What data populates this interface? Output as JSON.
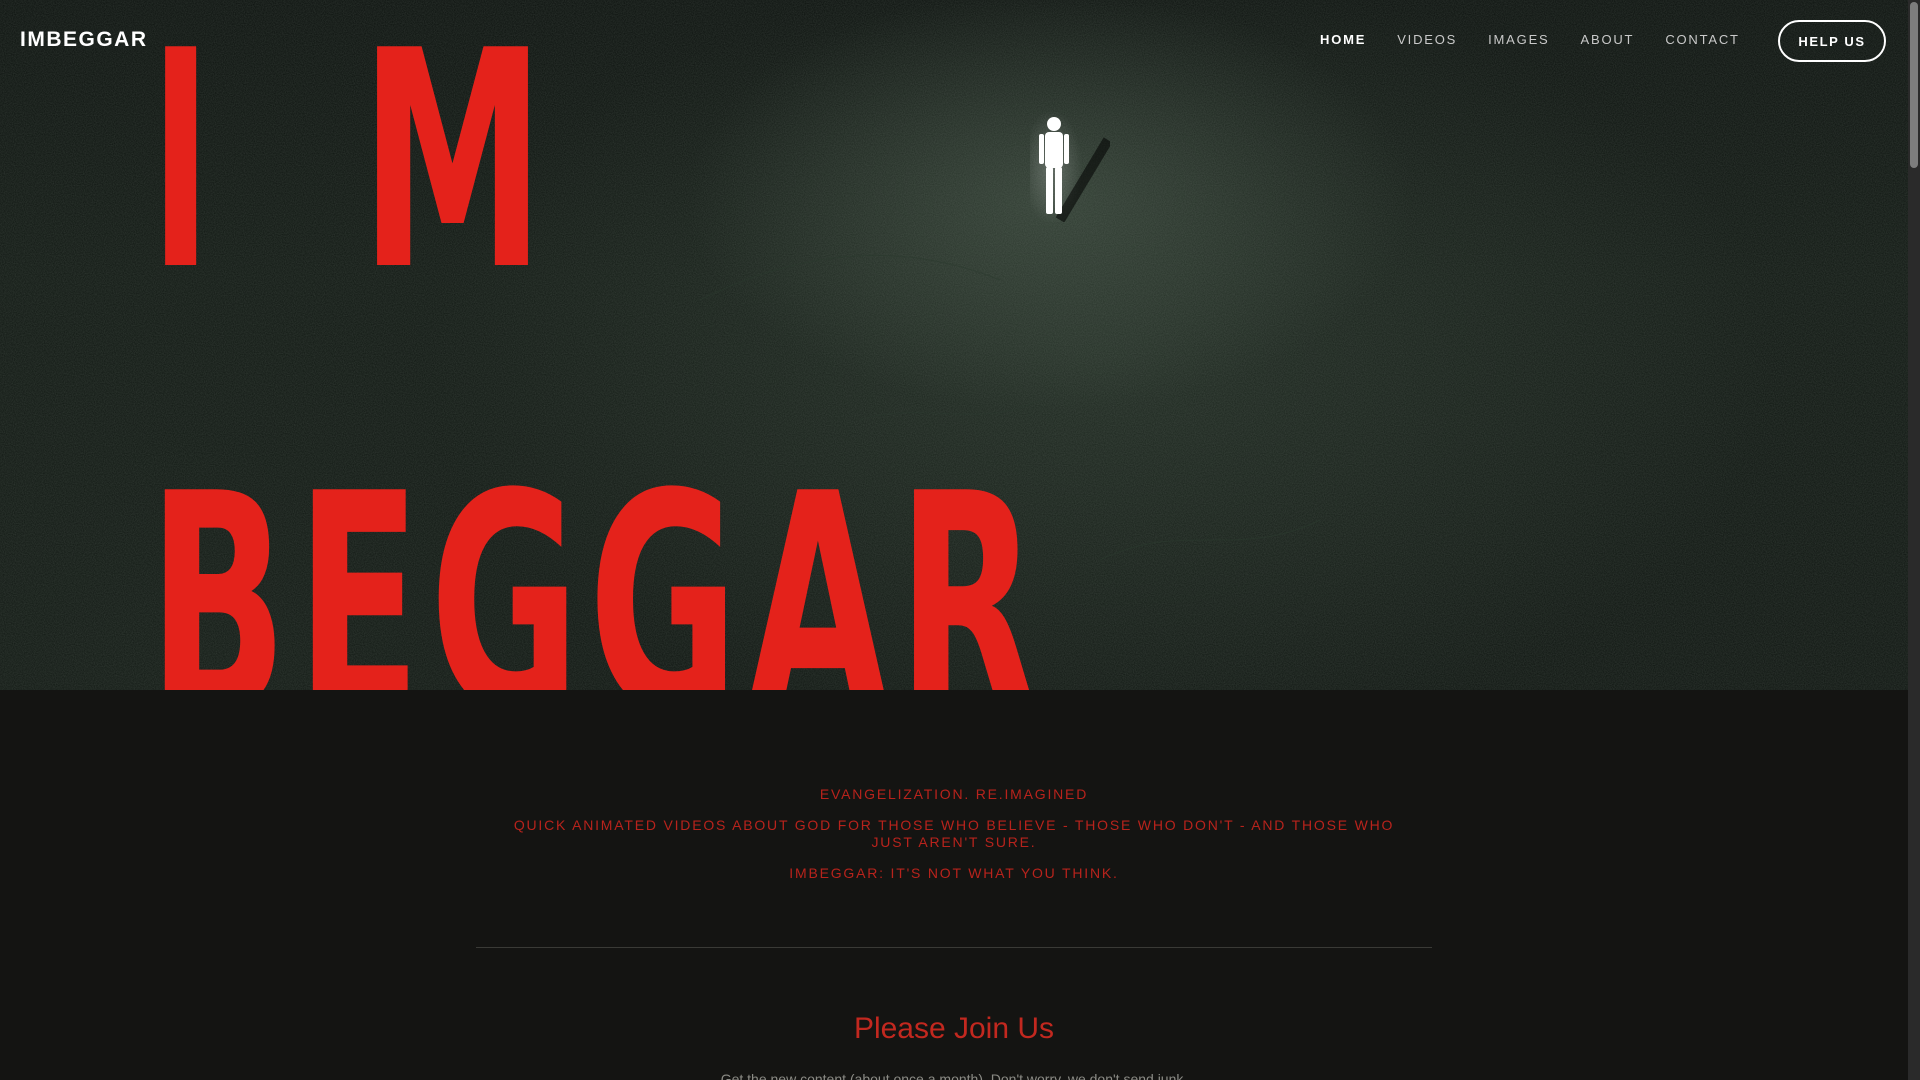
{
  "brand": {
    "logo_text": "IMBEGGAR"
  },
  "nav": {
    "items": [
      {
        "label": "HOME",
        "active": true
      },
      {
        "label": "VIDEOS",
        "active": false
      },
      {
        "label": "IMAGES",
        "active": false
      },
      {
        "label": "ABOUT",
        "active": false
      },
      {
        "label": "CONTACT",
        "active": false
      }
    ],
    "cta_label": "HELP US"
  },
  "hero": {
    "title_line1_letter1": "I",
    "title_line1_letter2": "M",
    "title_line2": "BEGGAR",
    "title_color": "#e4221b",
    "figure_icon": "glowing-human-figure-icon"
  },
  "intro": {
    "line1": "EVANGELIZATION. RE.IMAGINED",
    "line2": "QUICK ANIMATED VIDEOS ABOUT GOD FOR THOSE WHO BELIEVE - THOSE WHO DON'T - AND THOSE WHO JUST AREN'T SURE.",
    "line3": "IMBEGGAR: IT'S NOT WHAT YOU THINK.",
    "accent_color": "#b8231c"
  },
  "signup": {
    "title": "Please Join Us",
    "subtitle": "Get the new content (about once a month). Don't worry, we don't send junk."
  }
}
